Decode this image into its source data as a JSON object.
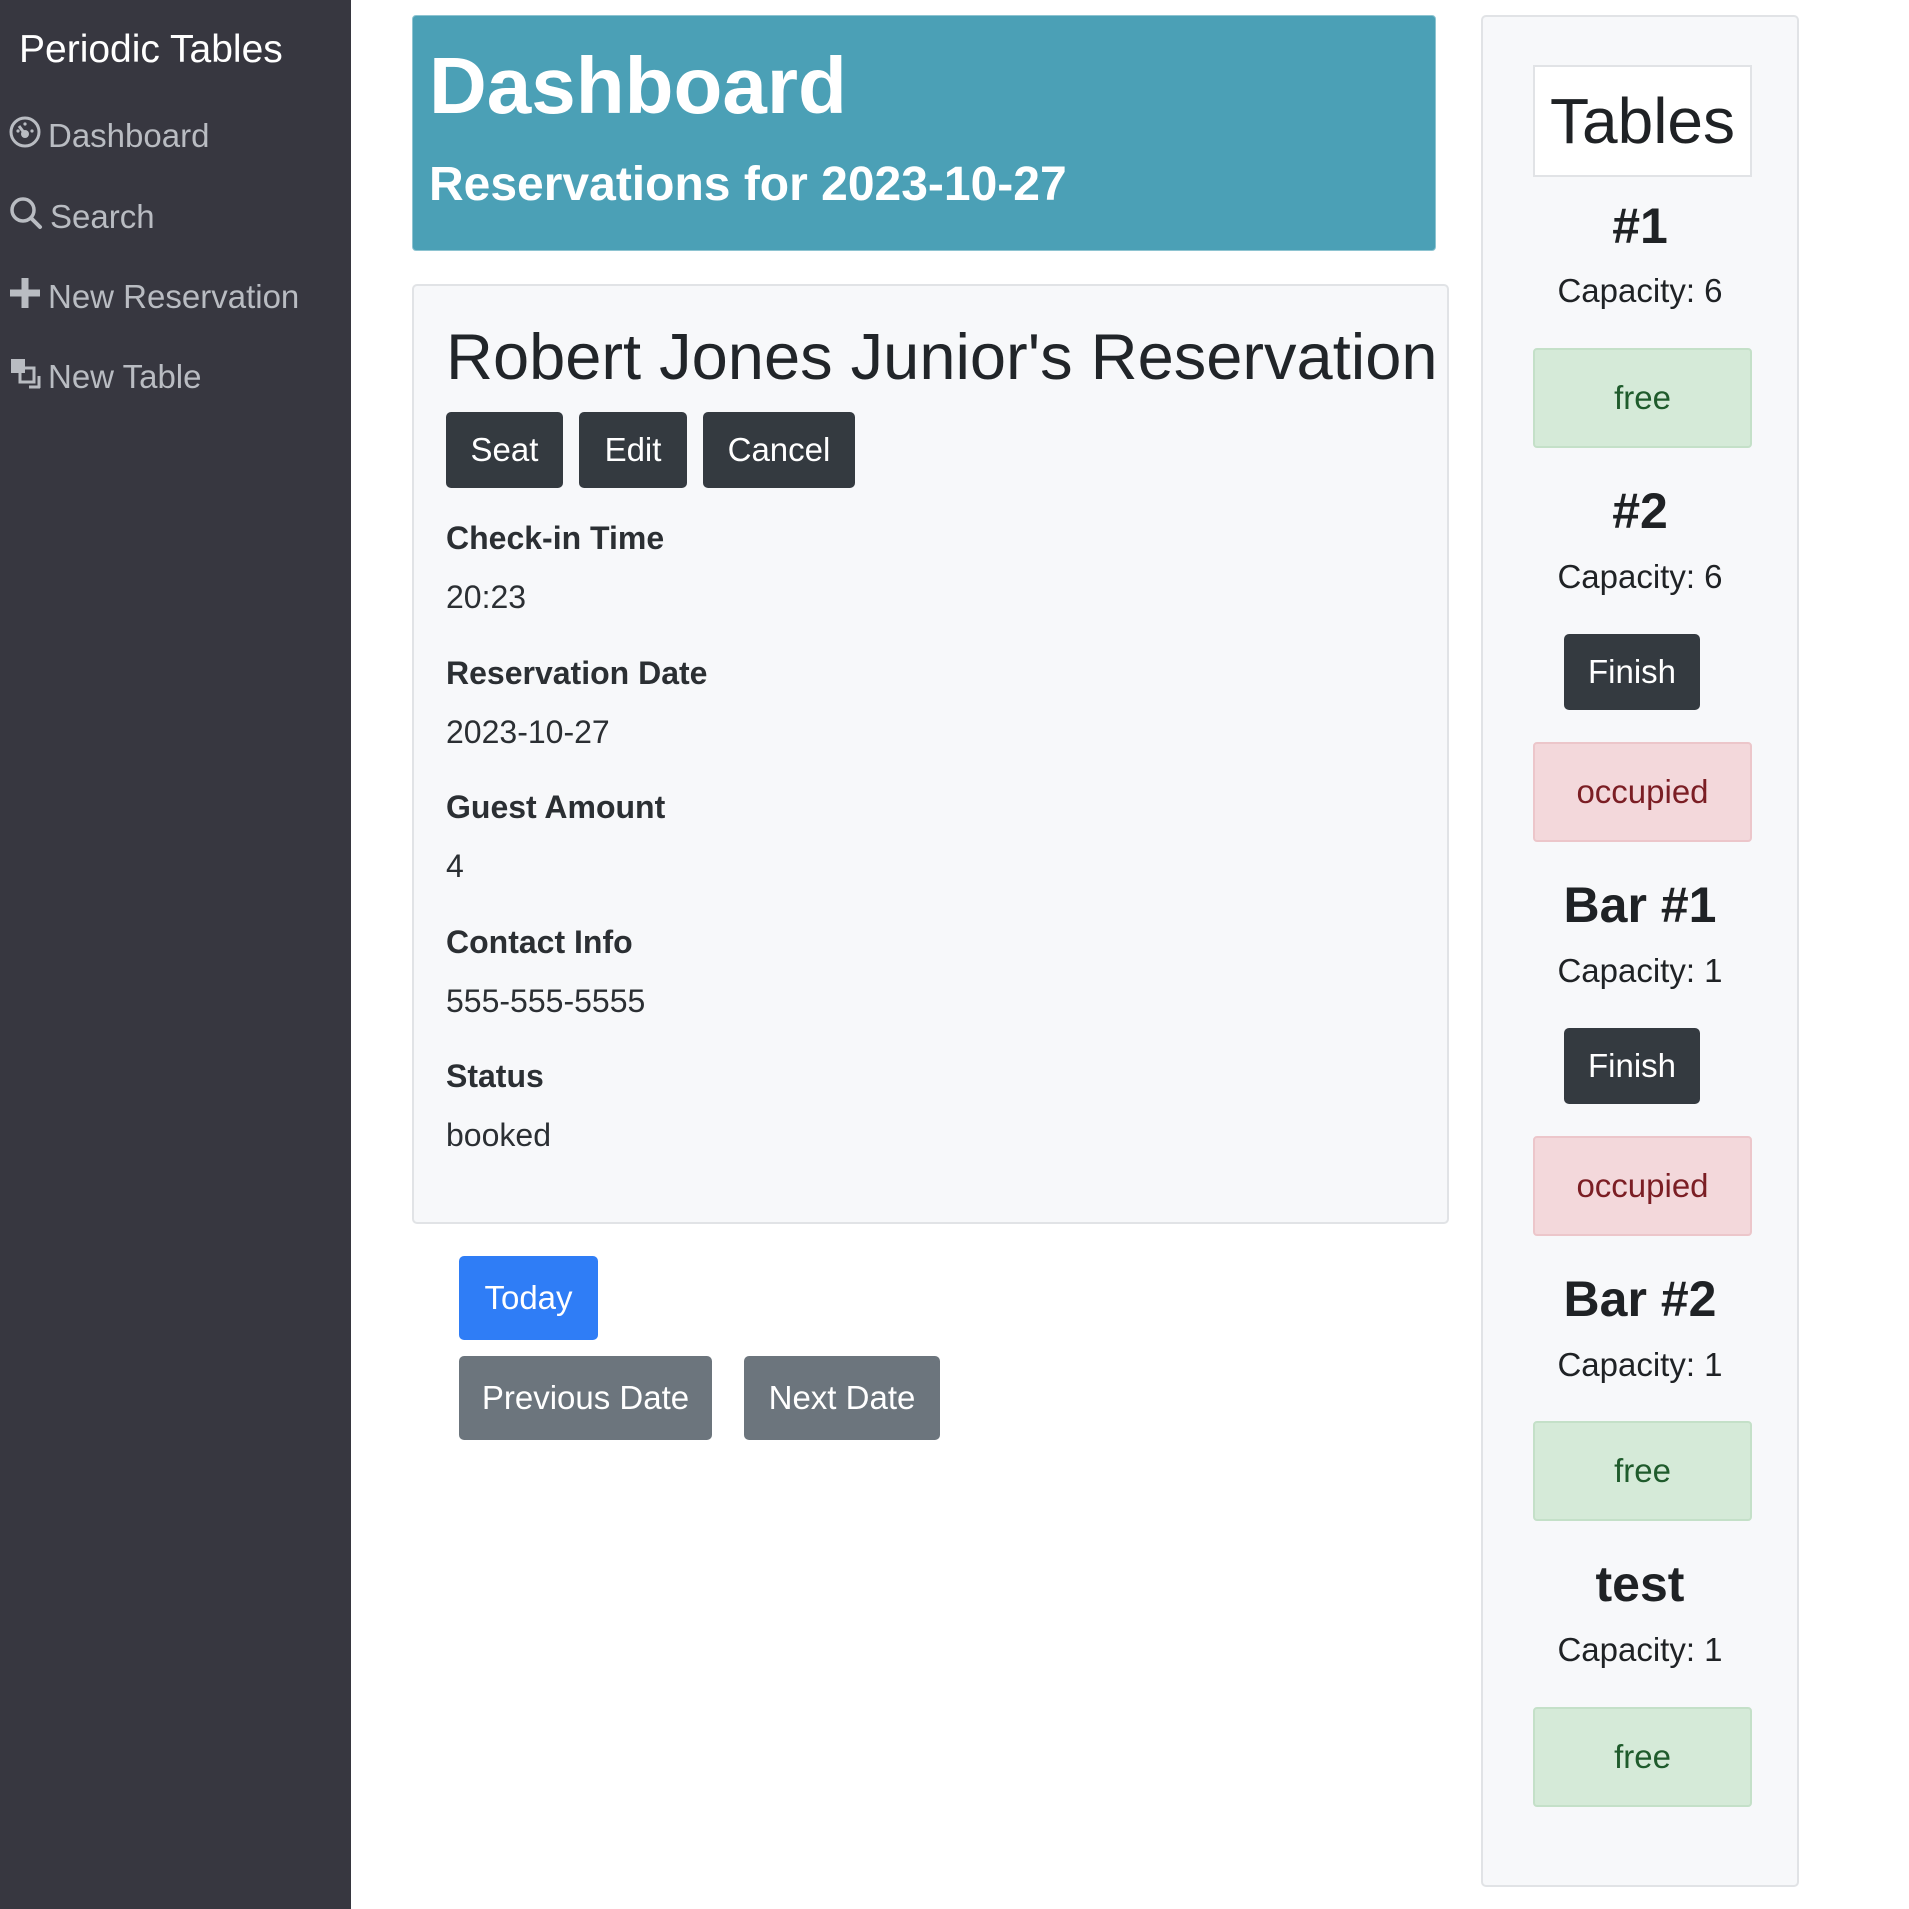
{
  "sidebar": {
    "brand": "Periodic Tables",
    "items": [
      {
        "label": "Dashboard",
        "icon": "dashboard-icon"
      },
      {
        "label": "Search",
        "icon": "search-icon"
      },
      {
        "label": "New Reservation",
        "icon": "plus-icon"
      },
      {
        "label": "New Table",
        "icon": "layers-icon"
      }
    ]
  },
  "header": {
    "title": "Dashboard",
    "subtitle": "Reservations for 2023-10-27"
  },
  "reservation": {
    "title": "Robert Jones Junior's Reservation",
    "actions": {
      "seat": "Seat",
      "edit": "Edit",
      "cancel": "Cancel"
    },
    "fields": [
      {
        "label": "Check-in Time",
        "value": "20:23"
      },
      {
        "label": "Reservation Date",
        "value": "2023-10-27"
      },
      {
        "label": "Guest Amount",
        "value": "4"
      },
      {
        "label": "Contact Info",
        "value": "555-555-5555"
      },
      {
        "label": "Status",
        "value": "booked"
      }
    ]
  },
  "date_nav": {
    "today": "Today",
    "previous": "Previous Date",
    "next": "Next Date"
  },
  "tables": {
    "title": "Tables",
    "items": [
      {
        "name": "#1",
        "capacity": "Capacity: 6",
        "status": "free"
      },
      {
        "name": "#2",
        "capacity": "Capacity: 6",
        "finish": "Finish",
        "status": "occupied"
      },
      {
        "name": "Bar #1",
        "capacity": "Capacity: 1",
        "finish": "Finish",
        "status": "occupied"
      },
      {
        "name": "Bar #2",
        "capacity": "Capacity: 1",
        "status": "free"
      },
      {
        "name": "test",
        "capacity": "Capacity: 1",
        "status": "free"
      }
    ]
  },
  "colors": {
    "sidebar_bg": "#373740",
    "header_bg": "#4ba0b6",
    "primary": "#2f7df6",
    "secondary": "#6c757d",
    "dark": "#343a40",
    "free_bg": "#d5ead8",
    "occupied_bg": "#f3d8db"
  }
}
